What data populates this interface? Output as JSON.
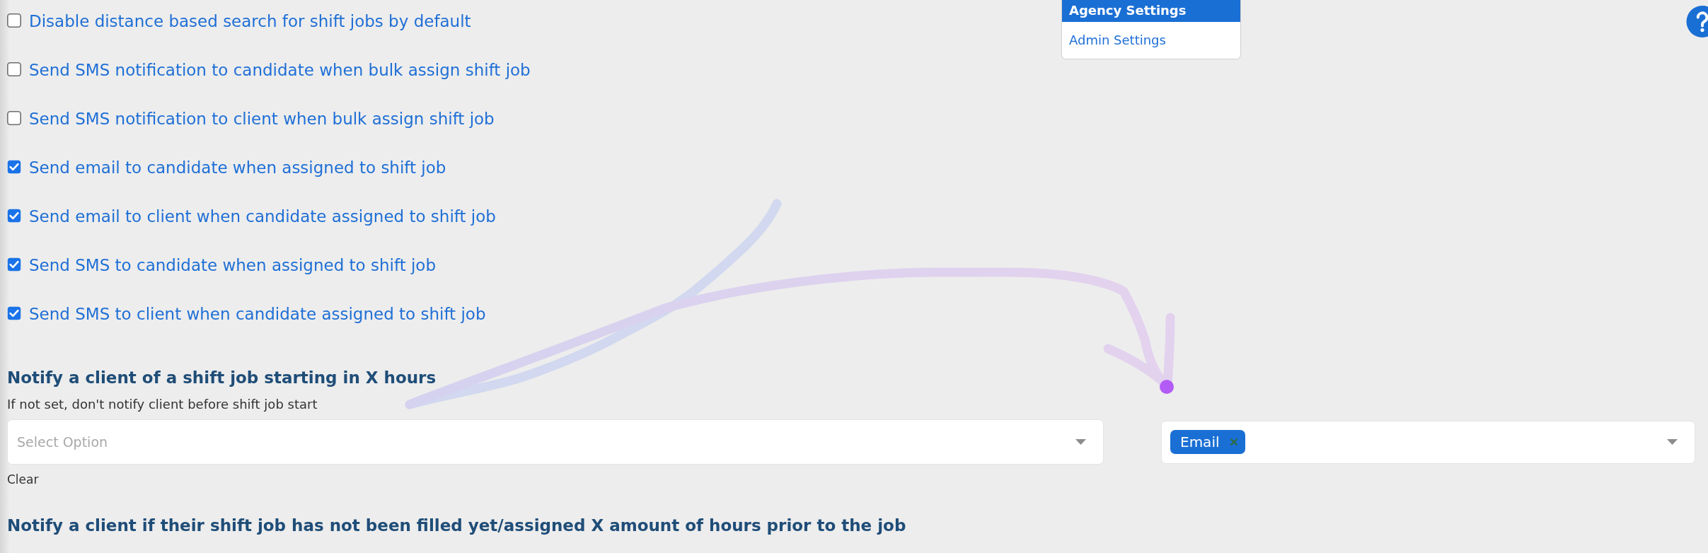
{
  "menu": {
    "items": [
      {
        "label": "Agency Settings",
        "selected": true
      },
      {
        "label": "Admin Settings",
        "selected": false
      }
    ]
  },
  "options": [
    {
      "label": "Disable distance based search for shift jobs by default",
      "checked": false
    },
    {
      "label": "Send SMS notification to candidate when bulk assign shift job",
      "checked": false
    },
    {
      "label": "Send SMS notification to client when bulk assign shift job",
      "checked": false
    },
    {
      "label": "Send email to candidate when assigned to shift job",
      "checked": true
    },
    {
      "label": "Send email to client when candidate assigned to shift job",
      "checked": true
    },
    {
      "label": "Send SMS to candidate when assigned to shift job",
      "checked": true
    },
    {
      "label": "Send SMS to client when candidate assigned to shift job",
      "checked": true
    }
  ],
  "notify_start": {
    "title": "Notify a client of a shift job starting in X hours",
    "hint": "If not set, don't notify client before shift job start",
    "hours_select": {
      "placeholder": "Select Option"
    },
    "clear_link": "Clear",
    "channel_select": {
      "tags": [
        {
          "label": "Email"
        }
      ]
    }
  },
  "notify_unfilled": {
    "title": "Notify a client if their shift job has not been filled yet/assigned X amount of hours prior to the job"
  }
}
